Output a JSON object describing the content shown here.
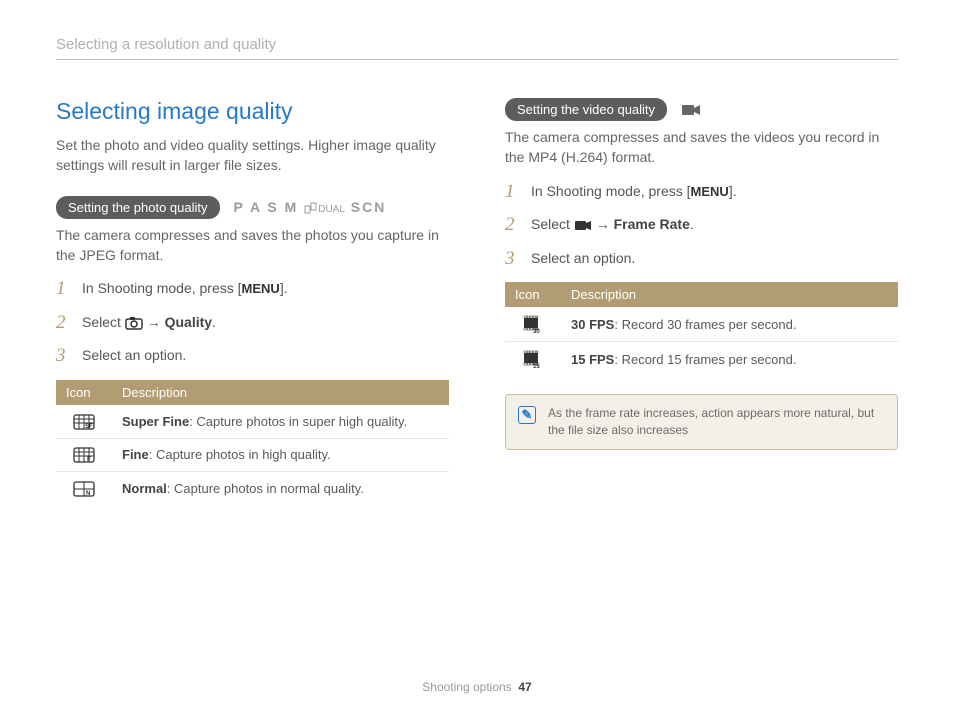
{
  "breadcrumb": "Selecting a resolution and quality",
  "title": "Selecting image quality",
  "intro": "Set the photo and video quality settings. Higher image quality settings will result in larger file sizes.",
  "photo": {
    "pill": "Setting the photo quality",
    "modes": "P A S M",
    "modes_extra": "SCN",
    "desc": "The camera compresses and saves the photos you capture in the JPEG format.",
    "step1_a": "In Shooting mode, press [",
    "step1_menu": "MENU",
    "step1_b": "].",
    "step2_a": "Select ",
    "step2_b": " → ",
    "step2_c": "Quality",
    "step2_d": ".",
    "step3": "Select an option.",
    "th_icon": "Icon",
    "th_desc": "Description",
    "rows": [
      {
        "label": "Super Fine",
        "desc": ": Capture photos in super high quality."
      },
      {
        "label": "Fine",
        "desc": ": Capture photos in high quality."
      },
      {
        "label": "Normal",
        "desc": ": Capture photos in normal quality."
      }
    ]
  },
  "video": {
    "pill": "Setting the video quality",
    "desc": "The camera compresses and saves the videos you record in the MP4 (H.264) format.",
    "step1_a": "In Shooting mode, press [",
    "step1_menu": "MENU",
    "step1_b": "].",
    "step2_a": "Select ",
    "step2_b": " → ",
    "step2_c": "Frame Rate",
    "step2_d": ".",
    "step3": "Select an option.",
    "th_icon": "Icon",
    "th_desc": "Description",
    "rows": [
      {
        "label": "30 FPS",
        "desc": ": Record 30 frames per second."
      },
      {
        "label": "15 FPS",
        "desc": ": Record 15 frames per second."
      }
    ],
    "note": "As the frame rate increases, action appears more natural, but the file size also increases"
  },
  "footer": {
    "section": "Shooting options",
    "page": "47"
  }
}
